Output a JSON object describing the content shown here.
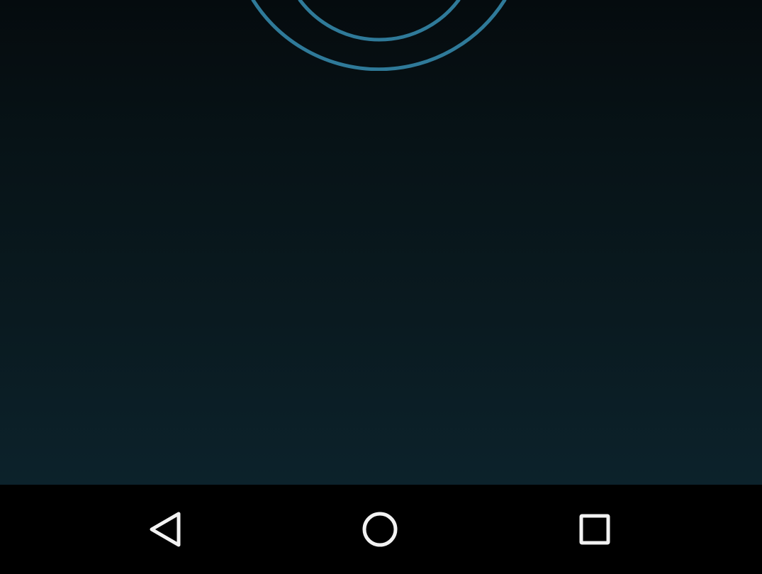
{
  "theme": {
    "ring_color": "#2f7a99",
    "nav_icon_color": "#f2f2f2",
    "navbar_color": "#000000"
  },
  "navigation_bar": {
    "buttons": [
      {
        "icon": "back-triangle-icon"
      },
      {
        "icon": "home-circle-icon"
      },
      {
        "icon": "recents-square-icon"
      }
    ]
  }
}
